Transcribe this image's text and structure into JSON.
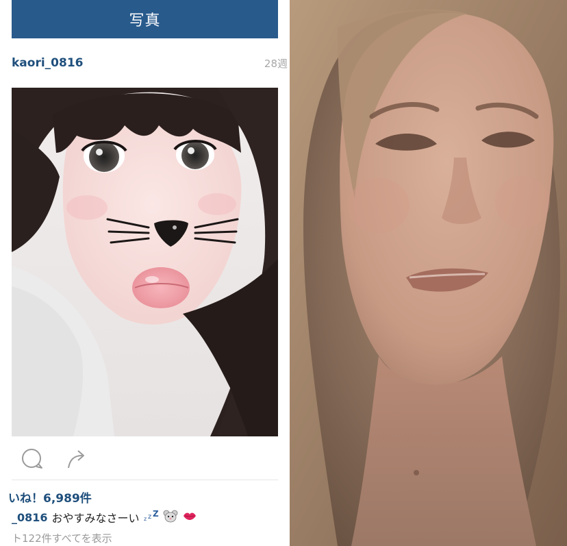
{
  "left": {
    "header": {
      "title": "写真"
    },
    "post": {
      "username": "kaori_0816",
      "timestamp": "28週",
      "likes": "いね！6,989件",
      "caption_user": "_0816",
      "caption_text": "おやすみなさーい",
      "caption_emojis": [
        "zzz-icon",
        "mouse-icon",
        "kiss-icon"
      ],
      "comments": "ト122件すべてを表示"
    },
    "actions": [
      "comment-icon",
      "share-icon"
    ]
  },
  "colors": {
    "header_bar": "#285a8c",
    "username": "#1f4f7c",
    "muted": "#9a9a9a"
  }
}
